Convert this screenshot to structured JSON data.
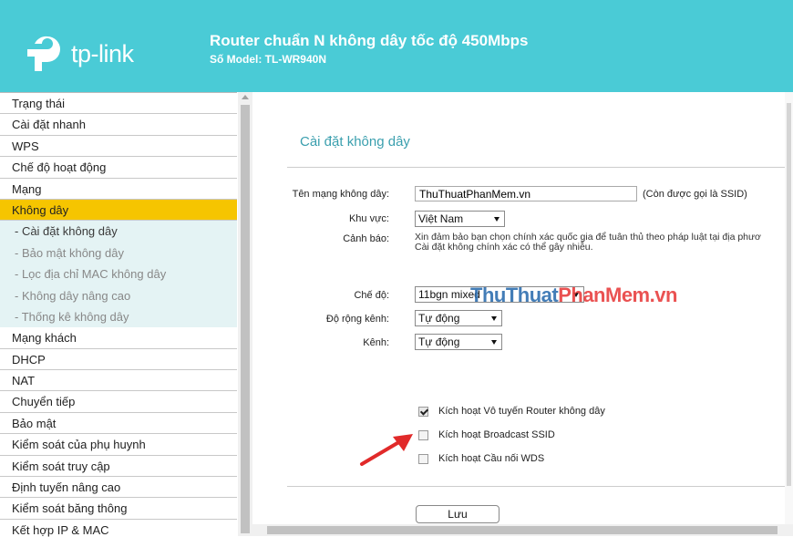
{
  "header": {
    "logo_text": "tp-link",
    "product_title": "Router chuẩn N không dây tốc độ 450Mbps",
    "model": "Số Model: TL-WR940N",
    "background_color": "#4acbd6"
  },
  "sidebar": {
    "items": [
      {
        "label": "Trạng thái"
      },
      {
        "label": "Cài đặt nhanh"
      },
      {
        "label": "WPS"
      },
      {
        "label": "Chế độ hoạt động"
      },
      {
        "label": "Mạng"
      },
      {
        "label": "Không dây",
        "active": true
      },
      {
        "label": "- Cài đặt không dây",
        "sub": true,
        "current": true
      },
      {
        "label": "- Bảo mật không dây",
        "sub": true
      },
      {
        "label": "- Lọc địa chỉ MAC không dây",
        "sub": true
      },
      {
        "label": "- Không dây nâng cao",
        "sub": true
      },
      {
        "label": "- Thống kê không dây",
        "sub": true
      },
      {
        "label": "Mạng khách"
      },
      {
        "label": "DHCP"
      },
      {
        "label": "NAT"
      },
      {
        "label": "Chuyển tiếp"
      },
      {
        "label": "Bảo mật"
      },
      {
        "label": "Kiểm soát của phụ huynh"
      },
      {
        "label": "Kiểm soát truy cập"
      },
      {
        "label": "Định tuyến nâng cao"
      },
      {
        "label": "Kiểm soát băng thông"
      },
      {
        "label": "Kết hợp IP & MAC"
      }
    ],
    "active_color": "#f6c500"
  },
  "main": {
    "section_title": "Cài đặt không dây",
    "ssid": {
      "label": "Tên mạng không dây:",
      "value": "ThuThuatPhanMem.vn",
      "note": "(Còn được gọi là SSID)"
    },
    "region": {
      "label": "Khu vực:",
      "value": "Việt Nam"
    },
    "warning": {
      "label": "Cảnh báo:",
      "line1": "Xin đảm bảo bạn chọn chính xác quốc gia để tuân thủ theo pháp luật tại địa phươ",
      "line2": "Cài đặt không chính xác có thể gây nhiễu."
    },
    "mode": {
      "label": "Chế độ:",
      "value": "11bgn mixed"
    },
    "channel_width": {
      "label": "Độ rộng kênh:",
      "value": "Tự động"
    },
    "channel": {
      "label": "Kênh:",
      "value": "Tự động"
    },
    "checkboxes": [
      {
        "label": "Kích hoạt Vô tuyến Router không dây",
        "checked": true
      },
      {
        "label": "Kích hoạt Broadcast SSID",
        "checked": false
      },
      {
        "label": "Kích hoạt Cầu nối WDS",
        "checked": false
      }
    ],
    "save_label": "Lưu"
  },
  "watermark": {
    "part_a": "ThuThuat",
    "part_b": "PhanMem.vn"
  }
}
